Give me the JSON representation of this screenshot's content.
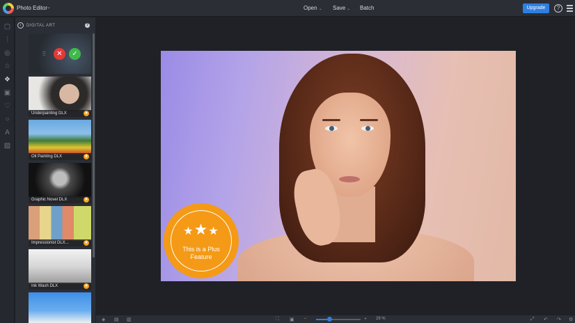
{
  "header": {
    "app_name": "Photo Editor",
    "menu": [
      "Open",
      "Save",
      "Batch"
    ],
    "upgrade_label": "Upgrade",
    "help_symbol": "?"
  },
  "rail": {
    "icons": [
      "image-icon",
      "sliders-icon",
      "eye-icon",
      "star-icon",
      "effects-icon",
      "frame-icon",
      "heart-icon",
      "circle-icon",
      "text-icon",
      "texture-icon"
    ]
  },
  "panel": {
    "title": "DIGITAL ART",
    "help_symbol": "?",
    "thumbs": [
      {
        "label": "Underpainting DLX",
        "star": "★"
      },
      {
        "label": "Oil Painting DLX",
        "star": "★"
      },
      {
        "label": "Graphic Novel DLX",
        "star": "★"
      },
      {
        "label": "Impressionist DLX...",
        "star": "★"
      },
      {
        "label": "Ink Wash DLX",
        "star": "★"
      }
    ],
    "cancel_symbol": "✕",
    "apply_symbol": "✓"
  },
  "canvas": {
    "badge_line1": "This is a Plus",
    "badge_line2": "Feature"
  },
  "bottombar": {
    "zoom_label": "29 %",
    "zoom_fraction": 0.29,
    "zoom_minus": "−",
    "zoom_plus": "+"
  },
  "colors": {
    "accent": "#2f7fe0",
    "badge": "#f49a16",
    "cancel": "#e53935",
    "apply": "#3fba4a"
  }
}
